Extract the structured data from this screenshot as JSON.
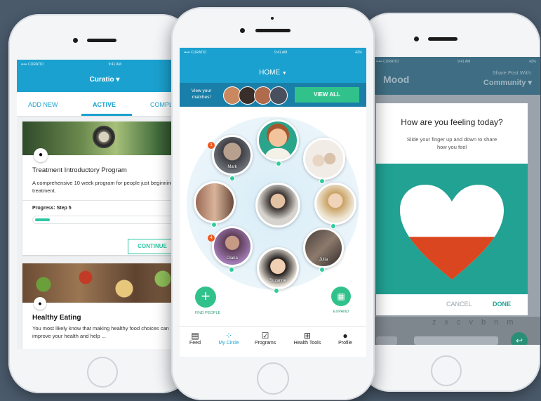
{
  "left_phone": {
    "status": {
      "carrier": "••••• CURATIO",
      "time": "9:41 AM"
    },
    "header_title": "Curatio ▾",
    "tabs": [
      {
        "label": "ADD NEW"
      },
      {
        "label": "ACTIVE"
      },
      {
        "label": "COMPL"
      }
    ],
    "program_card": {
      "title": "Treatment Introductory Program",
      "description": "A comprehensive 10 week program for people just beginning treatment.",
      "progress_label": "Progress: Step 5",
      "progress_fraction": 0.1,
      "continue_label": "CONTINUE"
    },
    "food_card": {
      "title": "Healthy Eating",
      "description": "You most likely know that making healthy food choices can improve your health and help ..."
    }
  },
  "center_phone": {
    "status": {
      "carrier": "••••• CURATIO",
      "time": "9:41 AM",
      "battery": "42%"
    },
    "header_title": "HOME",
    "matches_text": "View your matches!",
    "view_all_label": "VIEW ALL",
    "circle": {
      "avatars": [
        {
          "name": "Mark",
          "badge": "1"
        },
        {
          "name": "",
          "badge": ""
        },
        {
          "name": "",
          "badge": ""
        },
        {
          "name": "",
          "badge": ""
        },
        {
          "name": "",
          "badge": ""
        },
        {
          "name": "",
          "badge": ""
        },
        {
          "name": "Diana",
          "badge": "4"
        },
        {
          "name": "Suzanne",
          "badge": ""
        },
        {
          "name": "Julia",
          "badge": ""
        }
      ]
    },
    "find_people_label": "FIND PEOPLE",
    "expand_label": "EXPAND",
    "nav": [
      {
        "label": "Feed",
        "icon": "feed-icon"
      },
      {
        "label": "My Circle",
        "icon": "circle-icon"
      },
      {
        "label": "Programs",
        "icon": "clipboard-icon"
      },
      {
        "label": "Health Tools",
        "icon": "medkit-icon"
      },
      {
        "label": "Profile",
        "icon": "profile-icon"
      }
    ]
  },
  "right_phone": {
    "status": {
      "carrier": "••••• CURATIO",
      "time": "9:41 AM",
      "battery": "42%"
    },
    "header_title": "Mood",
    "share_label": "Share Post With:",
    "share_value": "Community ▾",
    "question": "How are you feeling today?",
    "instruction": "Slide your finger up and down to share how you feel",
    "mood_level": 0.45,
    "cancel_label": "CANCEL",
    "done_label": "DONE",
    "keyboard_keys": [
      "z",
      "x",
      "c",
      "v",
      "b",
      "n",
      "m"
    ]
  },
  "colors": {
    "brand_blue": "#1ba1cf",
    "teal": "#25a89a",
    "green": "#31c28c",
    "heart_red": "#d9461f"
  }
}
